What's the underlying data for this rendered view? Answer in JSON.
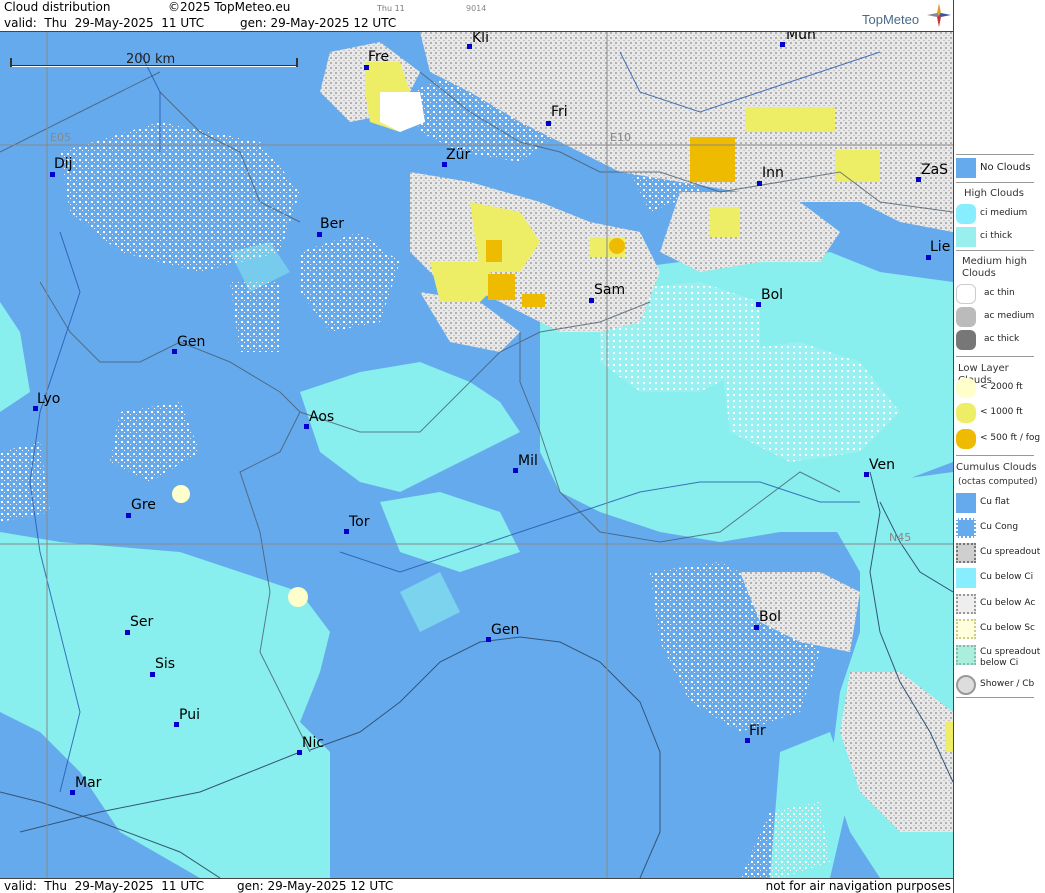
{
  "header": {
    "title": "Cloud distribution",
    "copyright": "©2025 TopMeteo.eu",
    "small_day": "Thu 11",
    "small_code": "9014",
    "valid_line": "valid:  Thu  29-May-2025  11 UTC",
    "gen_line": "gen: 29-May-2025 12 UTC",
    "logo": "TopMeteo"
  },
  "footer": {
    "valid_line": "valid:  Thu  29-May-2025  11 UTC",
    "gen_line": "gen: 29-May-2025 12 UTC",
    "disclaimer": "not for air navigation purposes"
  },
  "map": {
    "scale_label": "200 km",
    "grid_labels": [
      "E05",
      "E10",
      "N45"
    ],
    "cities": [
      "Mün",
      "Kli",
      "Fre",
      "Fri",
      "Dij",
      "Zür",
      "Inn",
      "ZaS",
      "Ber",
      "Lie",
      "Sam",
      "Bol",
      "Gen",
      "Lyo",
      "Aos",
      "Mil",
      "Ven",
      "Gre",
      "Tor",
      "Ser",
      "Gen",
      "Bol",
      "Sis",
      "Pui",
      "Nic",
      "Fir",
      "Mar"
    ]
  },
  "legend": {
    "colors": {
      "no_clouds": "#66aaee",
      "ci_medium": "#88eeff",
      "ci_thick": "#99eeee",
      "ac_thin": "#ffffff",
      "ac_medium": "#bbbbbb",
      "ac_thick": "#777777",
      "low_2000": "#ffffcc",
      "low_1000": "#eeee66",
      "low_500": "#eebb00"
    },
    "no_clouds": "No Clouds",
    "high_title": "High Clouds",
    "ci_medium": "ci medium",
    "ci_thick": "ci thick",
    "medium_title": "Medium high Clouds",
    "ac_thin": "ac thin",
    "ac_medium": "ac medium",
    "ac_thick": "ac thick",
    "low_title": "Low Layer Clouds",
    "low_2000": "< 2000 ft",
    "low_1000": "< 1000 ft",
    "low_500": "< 500 ft / fog",
    "cu_title": "Cumulus Clouds",
    "cu_subtitle": "(octas computed)",
    "cu_flat": "Cu flat",
    "cu_cong": "Cu Cong",
    "cu_spreadout": "Cu spreadout",
    "cu_below_ci": "Cu below Ci",
    "cu_below_ac": "Cu below Ac",
    "cu_below_sc": "Cu below Sc",
    "cu_spreadout_ci_1": "Cu spreadout",
    "cu_spreadout_ci_2": "below Ci",
    "shower": "Shower / Cb"
  }
}
